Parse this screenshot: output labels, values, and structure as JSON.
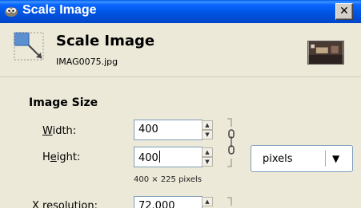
{
  "window": {
    "title": "Scale Image",
    "close_glyph": "✕"
  },
  "header": {
    "title": "Scale Image",
    "filename": "IMAG0075.jpg"
  },
  "image_size": {
    "section_title": "Image Size",
    "width_label_prefix": "",
    "width_label_mnemonic": "W",
    "width_label_rest": "idth:",
    "height_label_prefix": "H",
    "height_label_mnemonic": "e",
    "height_label_rest": "ight:",
    "width_value": "400",
    "height_value": "400",
    "dimensions_text": "400 × 225 pixels",
    "unit": "pixels",
    "xres_label": "X resolution:",
    "xres_value": "72.000"
  },
  "icons": {
    "app": "gimp-wilber-icon",
    "header": "scale-image-icon",
    "chain": "chain-link-icon",
    "spin_up": "arrow-up-icon",
    "spin_down": "arrow-down-icon",
    "combo": "chevron-down-icon"
  }
}
